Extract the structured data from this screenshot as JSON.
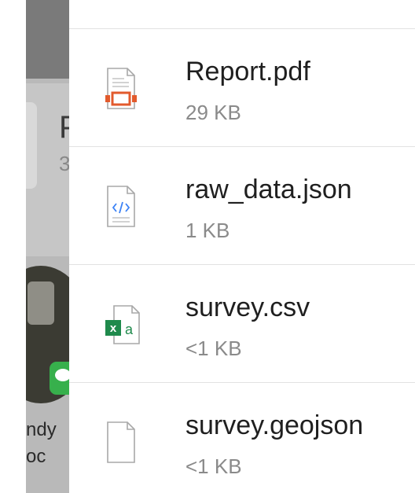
{
  "background_app": {
    "partial_title_letter": "P",
    "partial_subtitle_digit": "3",
    "partial_contact_name": "ndy\noc"
  },
  "files": [
    {
      "name": "Report.pdf",
      "size": "29 KB",
      "icon": "pdf-file-icon",
      "accent": "#e25a2c"
    },
    {
      "name": "raw_data.json",
      "size": "1 KB",
      "icon": "code-file-icon",
      "accent": "#3b82f6"
    },
    {
      "name": "survey.csv",
      "size": "<1 KB",
      "icon": "excel-file-icon",
      "accent": "#1f8a4c"
    },
    {
      "name": "survey.geojson",
      "size": "<1 KB",
      "icon": "generic-file-icon",
      "accent": "#8a8a8a"
    }
  ]
}
